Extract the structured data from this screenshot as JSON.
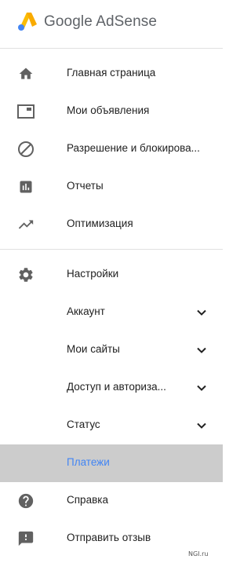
{
  "header": {
    "brand": "Google AdSense"
  },
  "nav": {
    "home": "Главная страница",
    "ads": "Мои объявления",
    "allow_block": "Разрешение и блокирова...",
    "reports": "Отчеты",
    "optimization": "Оптимизация",
    "settings": "Настройки",
    "account": "Аккаунт",
    "sites": "Мои сайты",
    "access": "Доступ и авториза...",
    "status": "Статус",
    "payments": "Платежи",
    "help": "Справка",
    "feedback": "Отправить отзыв"
  },
  "colors": {
    "selected_bg": "#cccccc",
    "selected_text": "#4285f4",
    "icon": "#616161"
  },
  "icons": {
    "home": "home-icon",
    "ads": "ad-units-icon",
    "allow_block": "block-icon",
    "reports": "bar-chart-icon",
    "optimization": "trending-up-icon",
    "settings": "gear-icon",
    "help": "help-icon",
    "feedback": "feedback-icon",
    "expand": "chevron-down-icon"
  },
  "watermark": "NGI.ru"
}
